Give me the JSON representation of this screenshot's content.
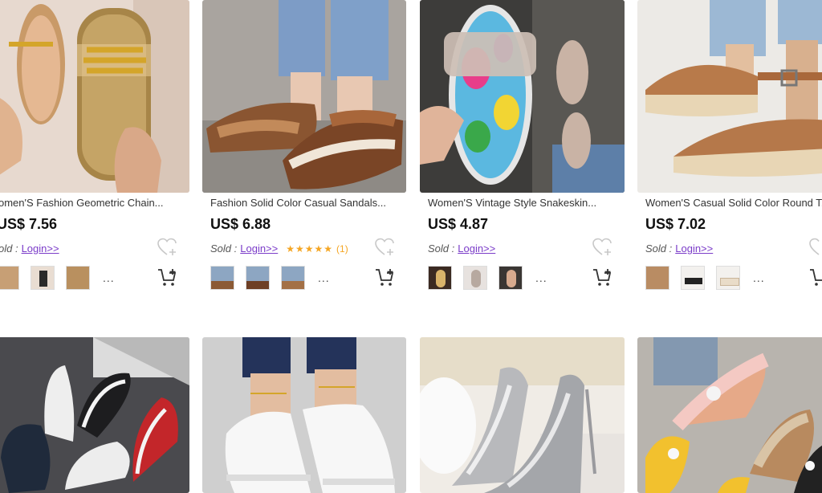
{
  "products": [
    {
      "title": "omen'S Fashion Geometric Chain...",
      "price": "US$ 7.56",
      "sold_label": "old :",
      "login_label": "Login>>",
      "rating": null,
      "thumbs": [
        "thumbnail-1",
        "thumbnail-2",
        "thumbnail-3"
      ]
    },
    {
      "title": "Fashion Solid Color Casual Sandals...",
      "price": "US$ 6.88",
      "sold_label": "Sold :",
      "login_label": "Login>>",
      "rating": {
        "stars": "★★★★★",
        "count": "(1)"
      },
      "thumbs": [
        "thumbnail-1",
        "thumbnail-2",
        "thumbnail-3"
      ]
    },
    {
      "title": "Women'S Vintage Style Snakeskin...",
      "price": "US$ 4.87",
      "sold_label": "Sold :",
      "login_label": "Login>>",
      "rating": null,
      "thumbs": [
        "thumbnail-1",
        "thumbnail-2",
        "thumbnail-3"
      ]
    },
    {
      "title": "Women'S Casual Solid Color Round T...",
      "price": "US$ 7.02",
      "sold_label": "Sold :",
      "login_label": "Login>>",
      "rating": null,
      "thumbs": [
        "thumbnail-1",
        "thumbnail-2",
        "thumbnail-3"
      ]
    }
  ],
  "more_label": "...",
  "icons": {
    "wishlist": "heart-plus-icon",
    "cart": "add-to-cart-icon"
  },
  "colors": {
    "login_link": "#7b3cc9",
    "stars": "#f5a623",
    "price": "#111111"
  }
}
